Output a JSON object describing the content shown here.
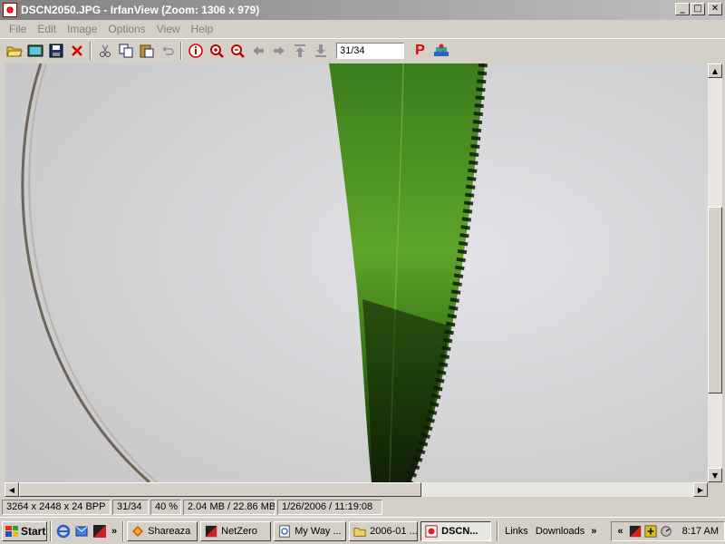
{
  "window": {
    "title": "DSCN2050.JPG - IrfanView (Zoom: 1306 x 979)",
    "minimize": "_",
    "maximize": "□",
    "close": "✕"
  },
  "menu": [
    "File",
    "Edit",
    "Image",
    "Options",
    "View",
    "Help"
  ],
  "toolbar": {
    "page_value": "31/34",
    "icons": [
      "open-folder",
      "slideshow",
      "save",
      "delete",
      "cut",
      "copy",
      "paste",
      "undo",
      "info",
      "zoom-in",
      "zoom-out",
      "previous",
      "next",
      "first",
      "last",
      "print",
      "paint"
    ]
  },
  "status": {
    "dimensions": "3264 x 2448 x 24 BPP",
    "index": "31/34",
    "zoom": "40 %",
    "size": "2.04 MB / 22.86 MB",
    "datetime": "1/26/2006 / 11:19:08"
  },
  "taskbar": {
    "start": "Start",
    "chevron": "»",
    "buttons": [
      {
        "label": "Shareaza",
        "icon": "shareaza-icon",
        "active": false
      },
      {
        "label": "NetZero",
        "icon": "netzero-icon",
        "active": false
      },
      {
        "label": "My Way ...",
        "icon": "ie-page-icon",
        "active": false
      },
      {
        "label": "2006-01 ...",
        "icon": "folder-icon",
        "active": false
      },
      {
        "label": "DSCN...",
        "icon": "irfanview-icon",
        "active": true
      }
    ],
    "links": "Links",
    "downloads": "Downloads",
    "tray_chevron": "«",
    "clock": "8:17 AM"
  },
  "colors": {
    "face": "#d4d0c8",
    "title_inactive": "#808080",
    "image_bg": "#d2d2d4",
    "leaf": "#2f6b12"
  }
}
